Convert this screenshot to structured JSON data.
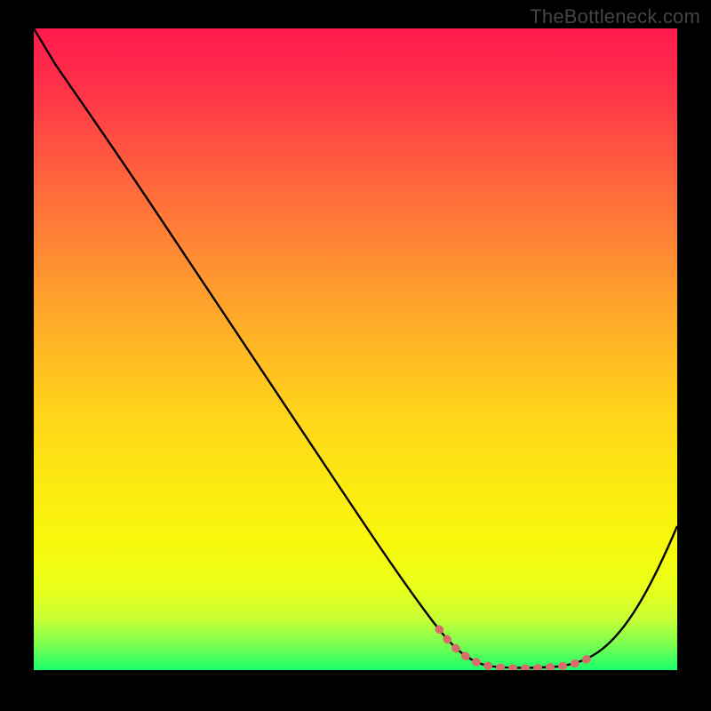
{
  "watermark": "TheBottleneck.com",
  "chart_data": {
    "type": "line",
    "title": "",
    "xlabel": "",
    "ylabel": "",
    "xlim": [
      0,
      100
    ],
    "ylim": [
      0,
      100
    ],
    "x": [
      0,
      5,
      12,
      20,
      30,
      40,
      50,
      58,
      65,
      70,
      74,
      78,
      82,
      86,
      90,
      94,
      100
    ],
    "y": [
      100,
      94,
      86,
      73,
      58,
      44,
      30,
      19,
      10,
      5,
      2,
      1,
      1,
      2,
      5,
      12,
      30
    ],
    "gradient_colors": [
      "#ff1a4d",
      "#ffd41a",
      "#1aff6a"
    ],
    "marker_region_x": [
      63,
      86
    ],
    "marker_color": "#d96b6a",
    "curve_color": "#000000"
  }
}
